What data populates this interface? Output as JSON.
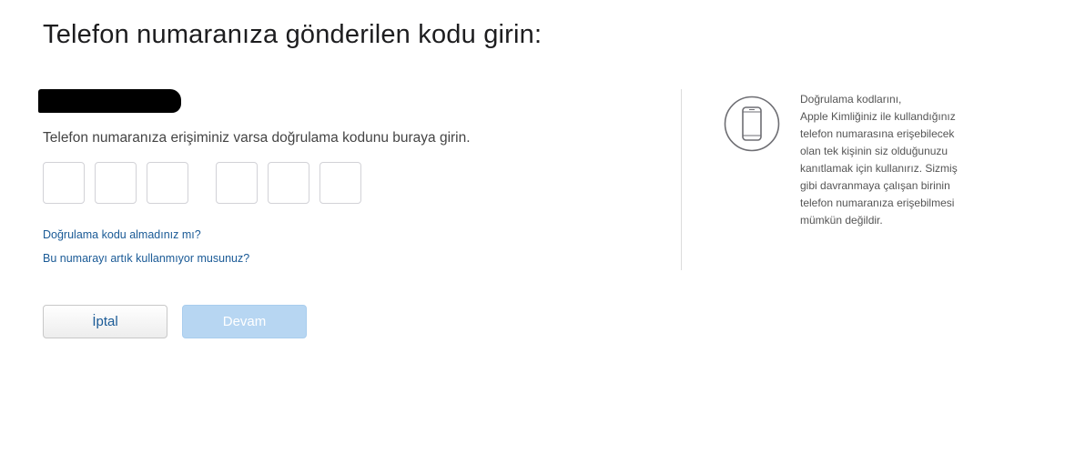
{
  "header": {
    "title": "Telefon numaranıza gönderilen kodu girin:"
  },
  "verification": {
    "instruction": "Telefon numaranıza erişiminiz varsa doğrulama kodunu buraya girin.",
    "code_digits": [
      "",
      "",
      "",
      "",
      "",
      ""
    ]
  },
  "links": {
    "no_code": "Doğrulama kodu almadınız mı?",
    "no_longer_use": "Bu numarayı artık kullanmıyor musunuz?"
  },
  "buttons": {
    "cancel": "İptal",
    "continue": "Devam"
  },
  "sidebar": {
    "icon": "iphone-icon",
    "lines": [
      "Doğrulama kodlarını,",
      "Apple Kimliğiniz ile kullandığınız",
      "telefon numarasına erişebilecek",
      "olan tek kişinin siz olduğunuzu",
      "kanıtlamak için kullanırız. Sizmiş",
      "gibi davranmaya çalışan birinin",
      "telefon numaranıza erişebilmesi",
      "mümkün değildir."
    ]
  },
  "colors": {
    "link": "#1a5a96",
    "continue_disabled": "#b7d6f2",
    "icon_stroke": "#6e6e73"
  }
}
